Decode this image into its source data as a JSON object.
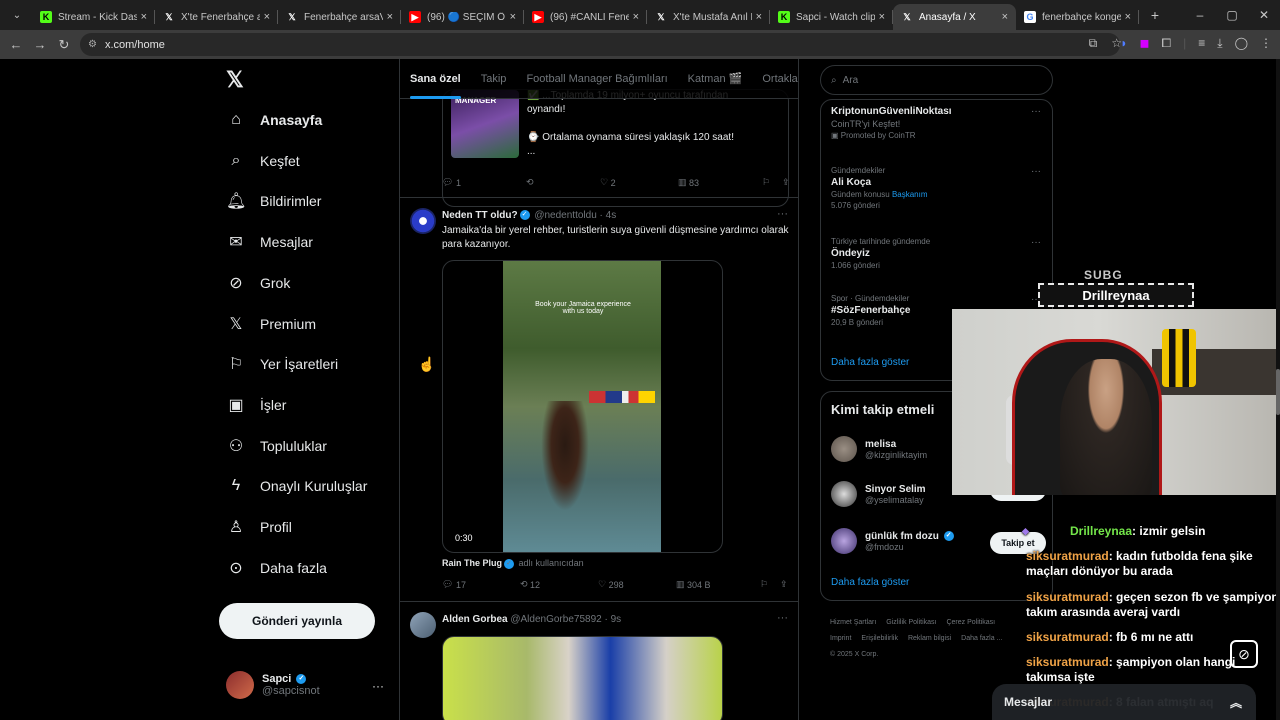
{
  "browser": {
    "tabs": [
      {
        "label": "Stream - Kick Dashboard",
        "fav": "K",
        "favbg": "#53fc18",
        "favfg": "#000"
      },
      {
        "label": "X'te Fenerbahçe arsa",
        "fav": "𝕏",
        "favbg": "transparent",
        "favfg": "#fff"
      },
      {
        "label": "Fenerbahçe arsaVev",
        "fav": "𝕏",
        "favbg": "transparent",
        "favfg": "#fff"
      },
      {
        "label": "(96) 🔵 SEÇİM Ö",
        "fav": "▶",
        "favbg": "#ff0000",
        "favfg": "#fff"
      },
      {
        "label": "(96) #CANLI Fenerbahçe",
        "fav": "▶",
        "favbg": "#ff0000",
        "favfg": "#fff"
      },
      {
        "label": "X'te Mustafa Anıl Ber",
        "fav": "𝕏",
        "favbg": "transparent",
        "favfg": "#fff"
      },
      {
        "label": "Sapci - Watch clips o",
        "fav": "K",
        "favbg": "#53fc18",
        "favfg": "#000"
      },
      {
        "label": "Anasayfa / X",
        "fav": "𝕏",
        "favbg": "transparent",
        "favfg": "#fff",
        "active": true
      },
      {
        "label": "fenerbahçe konger ü",
        "fav": "G",
        "favbg": "#fff",
        "favfg": "#4285f4"
      }
    ],
    "url": "x.com/home",
    "new_tab": "+",
    "close": "×"
  },
  "nav": {
    "logo": "𝕏",
    "items": [
      {
        "label": "Anasayfa",
        "icon": "⌂",
        "name": "home"
      },
      {
        "label": "Keşfet",
        "icon": "⌕",
        "name": "explore"
      },
      {
        "label": "Bildirimler",
        "icon": "🔔︎",
        "name": "notifications"
      },
      {
        "label": "Mesajlar",
        "icon": "✉",
        "name": "messages"
      },
      {
        "label": "Grok",
        "icon": "⊘",
        "name": "grok"
      },
      {
        "label": "Premium",
        "icon": "𝕏",
        "name": "premium"
      },
      {
        "label": "Yer İşaretleri",
        "icon": "⚐",
        "name": "bookmarks"
      },
      {
        "label": "İşler",
        "icon": "▣",
        "name": "jobs"
      },
      {
        "label": "Topluluklar",
        "icon": "⚇",
        "name": "communities"
      },
      {
        "label": "Onaylı Kuruluşlar",
        "icon": "ϟ",
        "name": "verified-orgs"
      },
      {
        "label": "Profil",
        "icon": "♙",
        "name": "profile"
      },
      {
        "label": "Daha fazla",
        "icon": "⊙",
        "name": "more"
      }
    ],
    "post_button": "Gönderi yayınla",
    "account": {
      "name": "Sapci",
      "handle": "@sapcisnot",
      "more": "···"
    }
  },
  "timeline": {
    "tabs": [
      "Sana özel",
      "Takip",
      "Football Manager Bağımlıları",
      "Katman 🎬",
      "Ortaklar"
    ],
    "prev_post": {
      "thumb_label": "MANAGER",
      "line1": "✅ ...Toplamda 19 milyon+ oyuncu tarafından",
      "line2": "oynandı!",
      "line3": "⌚ Ortalama oynama süresi yaklaşık 120 saat!",
      "line4": "...",
      "actions": {
        "reply": "1",
        "repost": "",
        "like": "2",
        "views": "83"
      }
    },
    "post1": {
      "name": "Neden TT oldu?",
      "handle": "@nedenttoldu",
      "time": "· 4s",
      "text": "Jamaika'da bir yerel rehber, turistlerin suya güvenli düşmesine yardımcı olarak para kazanıyor.",
      "video_caption": "Book your Jamaica experience with us today",
      "video_time": "0:30",
      "credit_name": "Rain The Plug",
      "credit_from": "adlı kullanıcıdan",
      "actions": {
        "reply": "17",
        "repost": "12",
        "like": "298",
        "views": "304 B"
      }
    },
    "post2": {
      "name": "Alden Gorbea",
      "handle": "@AldenGorbe75892",
      "time": "· 9s"
    }
  },
  "sidebar": {
    "search_placeholder": "Ara",
    "trends": [
      {
        "cat": "",
        "name": "KriptonunGüvenliNoktası",
        "count": "CoinTR'yi Keşfet!",
        "extra": "Promoted by CoinTR"
      },
      {
        "cat": "Gündemdekiler",
        "name": "Ali Koça",
        "count": "Gündem konusu",
        "link": "Başkanım",
        "extra": "5.076 gönderi"
      },
      {
        "cat": "Türkiye tarihinde gündemde",
        "name": "Öndeyiz",
        "count": "1.066 gönderi"
      },
      {
        "cat": "Spor · Gündemdekiler",
        "name": "#SözFenerbahçe",
        "count": "20,9 B gönderi"
      }
    ],
    "show_more": "Daha fazla göster",
    "who_title": "Kimi takip etmeli",
    "who": [
      {
        "name": "melisa",
        "handle": "@kizginliktayim",
        "button": "Takip et"
      },
      {
        "name": "Sinyor Selim",
        "handle": "@yselimatalay",
        "button": "Takip et"
      },
      {
        "name": "günlük fm dozu",
        "handle": "@fmdozu",
        "button": "Takip et"
      }
    ],
    "who_more": "Daha fazla göster",
    "footer": [
      "Hizmet Şartları",
      "Gizlilik Politikası",
      "Çerez Politikası",
      "Imprint",
      "Erişilebilirlik",
      "Reklam bilgisi",
      "Daha fazla ...",
      "© 2025 X Corp."
    ]
  },
  "stream": {
    "sub_label": "SUBG",
    "sub_name": "Drillreynaa",
    "chat": [
      {
        "user": "Drillreynaa",
        "text": ": izmir gelsin",
        "green": true
      },
      {
        "user": "siksuratmurad",
        "text": ": kadın futbolda fena şike maçları dönüyor bu arada"
      },
      {
        "user": "siksuratmurad",
        "text": ": geçen sezon fb ve şampiyon takım arasında averaj vardı"
      },
      {
        "user": "siksuratmurad",
        "text": ": fb 6 mı ne attı"
      },
      {
        "user": "siksuratmurad",
        "text": ": şampiyon olan hangi takımsa işte"
      },
      {
        "user": "siksuratmurad",
        "text": ": 8 falan atmıştı aq"
      }
    ],
    "messages_bar": "Mesajlar"
  },
  "colors": {
    "accent": "#1d9bf0",
    "bg": "#000000",
    "border": "#2f3336",
    "muted": "#71767b"
  }
}
